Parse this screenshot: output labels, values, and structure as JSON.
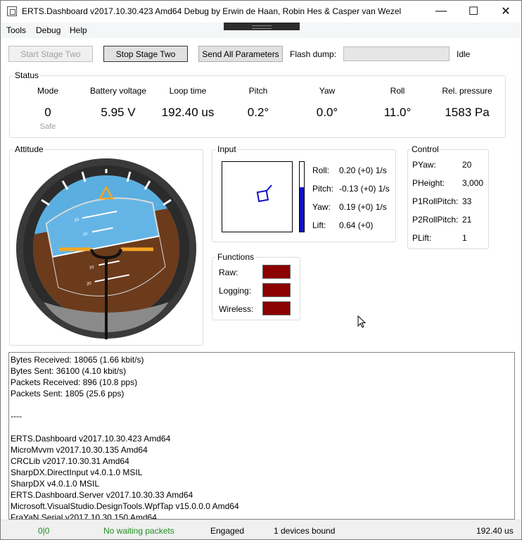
{
  "window": {
    "title": "ERTS.Dashboard v2017.10.30.423 Amd64 Debug by Erwin de Haan, Robin Hes & Casper van Wezel",
    "minimize": "—",
    "maximize": "☐",
    "close": "✕"
  },
  "menu": {
    "items": [
      "Tools",
      "Debug",
      "Help"
    ]
  },
  "toolbar": {
    "start_stage_two": "Start Stage Two",
    "stop_stage_two": "Stop Stage Two",
    "send_all_parameters": "Send All Parameters",
    "flash_dump_label": "Flash dump:",
    "flash_dump_progress": 0,
    "flash_dump_state": "Idle"
  },
  "status": {
    "title": "Status",
    "columns": [
      {
        "head": "Mode",
        "value": "0",
        "sub": "Safe"
      },
      {
        "head": "Battery voltage",
        "value": "5.95 V",
        "sub": ""
      },
      {
        "head": "Loop time",
        "value": "192.40 us",
        "sub": ""
      },
      {
        "head": "Pitch",
        "value": "0.2°",
        "sub": ""
      },
      {
        "head": "Yaw",
        "value": "0.0°",
        "sub": ""
      },
      {
        "head": "Roll",
        "value": "11.0°",
        "sub": ""
      },
      {
        "head": "Rel. pressure",
        "value": "1583 Pa",
        "sub": ""
      }
    ]
  },
  "attitude": {
    "title": "Attitude",
    "pitch_marks": [
      "20",
      "10",
      "10",
      "20",
      "10",
      "20"
    ],
    "colors": {
      "sky": "#5aaee0",
      "ground": "#6b3b1c",
      "bezel": "#3a3a3a",
      "wing": "#f5a623"
    }
  },
  "input": {
    "title": "Input",
    "lift_level": 0.64,
    "rows": [
      {
        "label": "Roll:",
        "value": "0.20 (+0) 1/s"
      },
      {
        "label": "Pitch:",
        "value": "-0.13 (+0) 1/s"
      },
      {
        "label": "Yaw:",
        "value": "0.19 (+0) 1/s"
      },
      {
        "label": "Lift:",
        "value": "0.64 (+0)"
      }
    ]
  },
  "control": {
    "title": "Control",
    "rows": [
      {
        "label": "PYaw:",
        "value": "20"
      },
      {
        "label": "PHeight:",
        "value": "3,000"
      },
      {
        "label": "P1RollPitch:",
        "value": "33"
      },
      {
        "label": "P2RollPitch:",
        "value": "21"
      },
      {
        "label": "PLift:",
        "value": "1"
      }
    ]
  },
  "functions": {
    "title": "Functions",
    "rows": [
      {
        "label": "Raw:",
        "color": "#8b0000"
      },
      {
        "label": "Logging:",
        "color": "#8b0000"
      },
      {
        "label": "Wireless:",
        "color": "#8b0000"
      }
    ]
  },
  "log": {
    "lines": [
      "Bytes Received: 18065 (1.66 kbit/s)",
      "Bytes Sent: 36100 (4.10 kbit/s)",
      "Packets Received: 896 (10.8 pps)",
      "Packets Sent: 1805 (25.6 pps)",
      "",
      "----",
      "",
      "ERTS.Dashboard v2017.10.30.423 Amd64",
      "MicroMvvm v2017.10.30.135 Amd64",
      "CRCLib v2017.10.30.31 Amd64",
      "SharpDX.DirectInput v4.0.1.0 MSIL",
      "SharpDX v4.0.1.0 MSIL",
      "ERTS.Dashboard.Server v2017.10.30.33 Amd64",
      "Microsoft.VisualStudio.DesignTools.WpfTap v15.0.0.0 Amd64",
      "FraYaN.Serial v2017.10.30.150 Amd64"
    ]
  },
  "statusbar": {
    "counter": "0|0",
    "packets": "No waiting packets",
    "engaged": "Engaged",
    "devices": "1 devices bound",
    "loop": "192.40 us",
    "ok_color": "#1f8f1f"
  }
}
